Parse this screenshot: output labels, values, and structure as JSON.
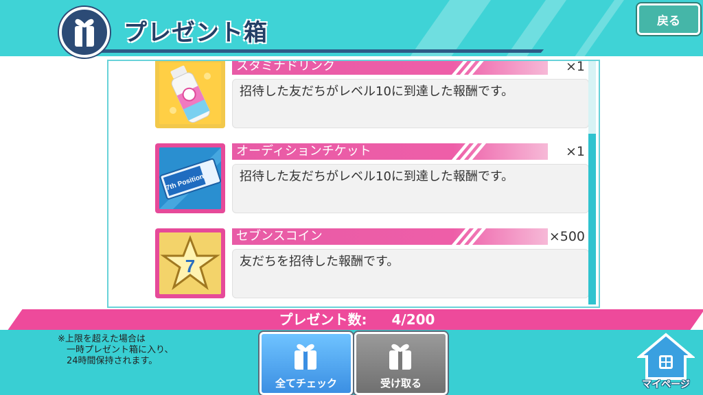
{
  "header": {
    "title": "プレゼント箱",
    "back_label": "戻る"
  },
  "items": [
    {
      "name": "スタミナドリンク",
      "quantity": "×1",
      "description": "招待した友だちがレベル10に到達した報酬です。",
      "icon": "drink-bottle-icon"
    },
    {
      "name": "オーディションチケット",
      "quantity": "×1",
      "description": "招待した友だちがレベル10に到達した報酬です。",
      "icon": "ticket-icon",
      "icon_text": "7th Position"
    },
    {
      "name": "セブンスコイン",
      "quantity": "×500",
      "description": "友だちを招待した報酬です。",
      "icon": "star-coin-icon",
      "icon_text": "7"
    }
  ],
  "footer": {
    "count_label": "プレゼント数:",
    "count_value": "4/200",
    "note": "※上限を超えた場合は\n　一時プレゼント箱に入り、\n　24時間保持されます。",
    "check_all_label": "全てチェック",
    "receive_label": "受け取る",
    "mypage_label": "マイページ"
  },
  "colors": {
    "accent_teal": "#3fd3d6",
    "accent_pink": "#ee4a9b",
    "navy": "#233f66"
  }
}
